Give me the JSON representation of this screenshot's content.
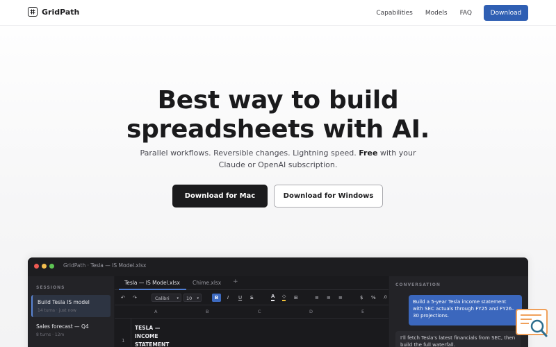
{
  "nav": {
    "brand": "GridPath",
    "links": [
      "Capabilities",
      "Models",
      "FAQ"
    ],
    "download_label": "Download"
  },
  "hero": {
    "title_line1": "Best way to build",
    "title_line2": "spreadsheets with AI.",
    "sub_part1": "Parallel workflows. Reversible changes. Lightning speed.",
    "sub_bold": "Free",
    "sub_part2": "with your",
    "sub_line2": "Claude or OpenAI subscription.",
    "cta_mac": "Download for Mac",
    "cta_windows": "Download for Windows"
  },
  "app": {
    "window_app": "GridPath",
    "window_sep": "·",
    "window_file": "Tesla — IS Model.xlsx",
    "sidebar": {
      "heading": "SESSIONS",
      "sessions": [
        {
          "title": "Build Tesla IS model",
          "meta": "14 turns · just now"
        },
        {
          "title": "Sales forecast — Q4",
          "meta": "8 turns · 12m"
        }
      ]
    },
    "tabs": [
      "Tesla — IS Model.xlsx",
      "Chime.xlsx",
      "+"
    ],
    "toolbar": {
      "undo": "↶",
      "redo": "↷",
      "font": "Calibri",
      "font_caret": "▾",
      "size": "10",
      "size_caret": "▾",
      "bold": "B",
      "italic": "I",
      "underline": "U",
      "strike": "S",
      "text_color": "A",
      "fill": "◇",
      "borders": "⊞",
      "align_left": "≡",
      "align_center": "≡",
      "align_right": "≡",
      "currency": "$",
      "percent": "%",
      "decimals": ".0"
    },
    "columns": [
      "A",
      "B",
      "C",
      "D",
      "E"
    ],
    "rows": [
      {
        "num": "1",
        "cells": [
          "TESLA — INCOME STATEMENT"
        ]
      }
    ],
    "conversation": {
      "heading": "CONVERSATION",
      "user_msg": "Build a 5-year Tesla income statement with SEC actuals through FY25 and FY26–30 projections.",
      "ai_msg": "I'll fetch Tesla's latest financials from SEC, then build the full waterfall."
    }
  },
  "colors": {
    "accent": "#2f5fb3",
    "dark": "#1b1b1d",
    "app_bg": "#1d1d20",
    "user_bubble": "#3b67bd"
  },
  "icons": {
    "brand": "grid-hash-icon",
    "corner": "document-search-icon"
  }
}
